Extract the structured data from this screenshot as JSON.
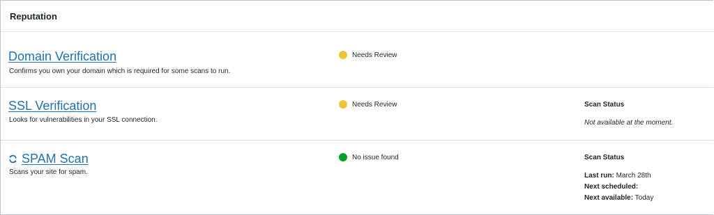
{
  "panel": {
    "title": "Reputation"
  },
  "colors": {
    "link": "#2271b1",
    "needs_review": "#f0c33c",
    "no_issue": "#00a32a"
  },
  "rows": [
    {
      "title": "Domain Verification",
      "description": "Confirms you own your domain which is required for some scans to run.",
      "status": "Needs Review",
      "status_color": "needs_review"
    },
    {
      "title": "SSL Verification",
      "description": "Looks for vulnerabilities in your SSL connection.",
      "status": "Needs Review",
      "status_color": "needs_review",
      "scan_status": {
        "heading": "Scan Status",
        "message": "Not available at the moment."
      }
    },
    {
      "title": "SPAM Scan",
      "icon": "refresh-icon",
      "description": "Scans your site for spam.",
      "status": "No issue found",
      "status_color": "no_issue",
      "scan_status": {
        "heading": "Scan Status",
        "last_run_label": "Last run:",
        "last_run_value": "March 28th",
        "next_scheduled_label": "Next scheduled:",
        "next_scheduled_value": "",
        "next_available_label": "Next available:",
        "next_available_value": "Today"
      }
    }
  ]
}
